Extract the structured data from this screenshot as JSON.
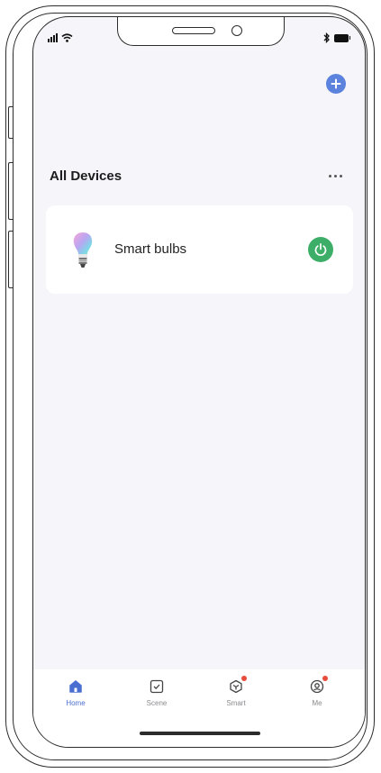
{
  "header": {
    "add_icon": "plus-circle-icon",
    "accent_color": "#5b82dc"
  },
  "devices_section": {
    "title": "All Devices",
    "more_icon": "ellipsis-icon"
  },
  "devices": [
    {
      "name": "Smart bulbs",
      "icon": "bulb-icon",
      "power_icon": "power-icon",
      "power_color": "#3dae67"
    }
  ],
  "tabs": [
    {
      "label": "Home",
      "icon": "home-icon",
      "active": true
    },
    {
      "label": "Scene",
      "icon": "checkbox-icon",
      "active": false
    },
    {
      "label": "Smart",
      "icon": "cube-icon",
      "active": false,
      "badge": true
    },
    {
      "label": "Me",
      "icon": "profile-icon",
      "active": false,
      "badge": true
    }
  ]
}
